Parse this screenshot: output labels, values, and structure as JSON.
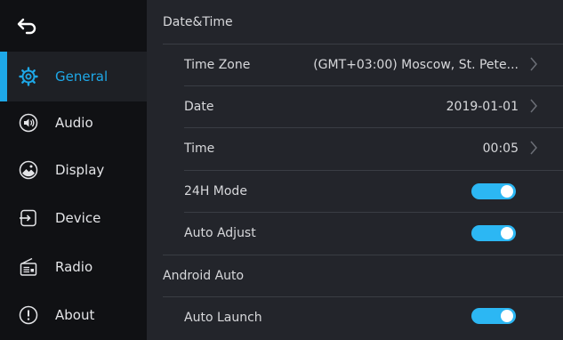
{
  "sidebar": {
    "items": [
      {
        "label": "General",
        "icon": "gear-icon"
      },
      {
        "label": "Audio",
        "icon": "speaker-icon"
      },
      {
        "label": "Display",
        "icon": "display-icon"
      },
      {
        "label": "Device",
        "icon": "device-input-icon"
      },
      {
        "label": "Radio",
        "icon": "radio-icon"
      },
      {
        "label": "About",
        "icon": "info-icon"
      }
    ],
    "active_index": 0
  },
  "main": {
    "section_datetime": "Date&Time",
    "time_zone": {
      "label": "Time Zone",
      "value": "(GMT+03:00) Moscow, St. Pete..."
    },
    "date": {
      "label": "Date",
      "value": "2019-01-01"
    },
    "time": {
      "label": "Time",
      "value": "00:05"
    },
    "mode_24h": {
      "label": "24H Mode",
      "state": "on"
    },
    "auto_adjust": {
      "label": "Auto Adjust",
      "state": "on"
    },
    "section_android": "Android Auto",
    "auto_launch": {
      "label": "Auto Launch",
      "state": "on"
    }
  },
  "colors": {
    "accent": "#1ea8e8",
    "toggle_on": "#2cb7f3"
  }
}
